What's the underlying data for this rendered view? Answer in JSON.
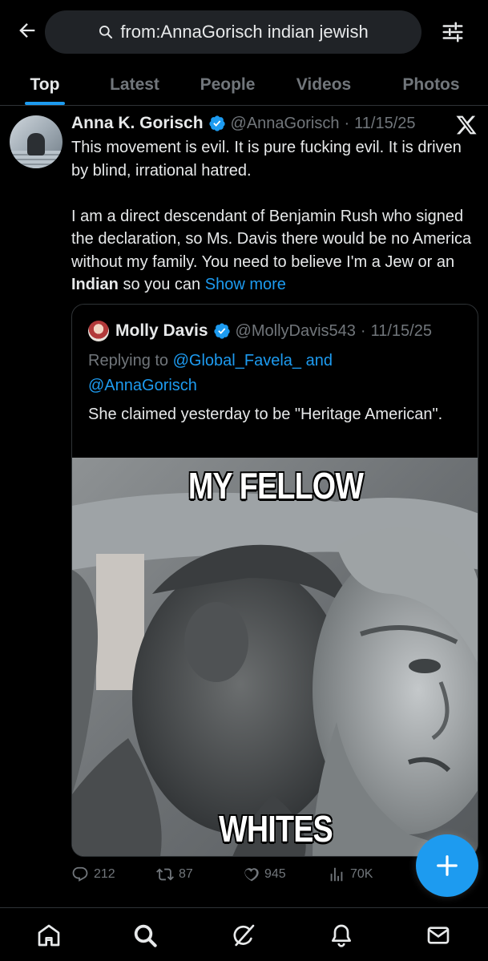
{
  "search": {
    "query": "from:AnnaGorisch indian jewish"
  },
  "tabs": [
    {
      "label": "Top",
      "active": true
    },
    {
      "label": "Latest"
    },
    {
      "label": "People"
    },
    {
      "label": "Videos"
    },
    {
      "label": "Photos"
    }
  ],
  "post": {
    "author_name": "Anna K. Gorisch",
    "handle": "@AnnaGorisch",
    "dot": "·",
    "date": "11/15/25",
    "para1": "This movement is evil. It is pure fucking evil. It is driven by blind, irrational hatred.",
    "para2_start": "I am a direct descendant of Benjamin Rush who signed the declaration, so Ms. Davis there would be no America without my family. You need to believe I'm a Jew or an ",
    "para2_bold": "Indian",
    "para2_end": " so you can ",
    "show_more": "Show more",
    "quote": {
      "author_name": "Molly Davis",
      "handle": "@MollyDavis543",
      "dot": "·",
      "date": "11/15/25",
      "replying_to": "Replying to ",
      "reply_link1": "@Global_Favela_ and",
      "reply_link2": "@AnnaGorisch",
      "text": "She claimed yesterday to be \"Heritage American\".",
      "meme_top": "MY FELLOW",
      "meme_bottom": "WHITES"
    },
    "stats": {
      "replies": "212",
      "reposts": "87",
      "likes": "945",
      "views": "70K"
    }
  },
  "colors": {
    "accent": "#1d9bf0",
    "muted": "#71767b",
    "text": "#e7e9ea",
    "background": "#000000"
  },
  "icons": {
    "back": "back-arrow-icon",
    "search": "search-icon",
    "filter": "filter-sliders-icon",
    "verified": "verified-badge-icon",
    "x": "x-logo-icon",
    "reply": "reply-icon",
    "repost": "repost-icon",
    "like": "heart-icon",
    "views": "views-icon",
    "compose": "plus-icon",
    "home": "home-icon",
    "explore": "search-icon",
    "grok": "grok-icon",
    "notifications": "bell-icon",
    "messages": "mail-icon"
  }
}
